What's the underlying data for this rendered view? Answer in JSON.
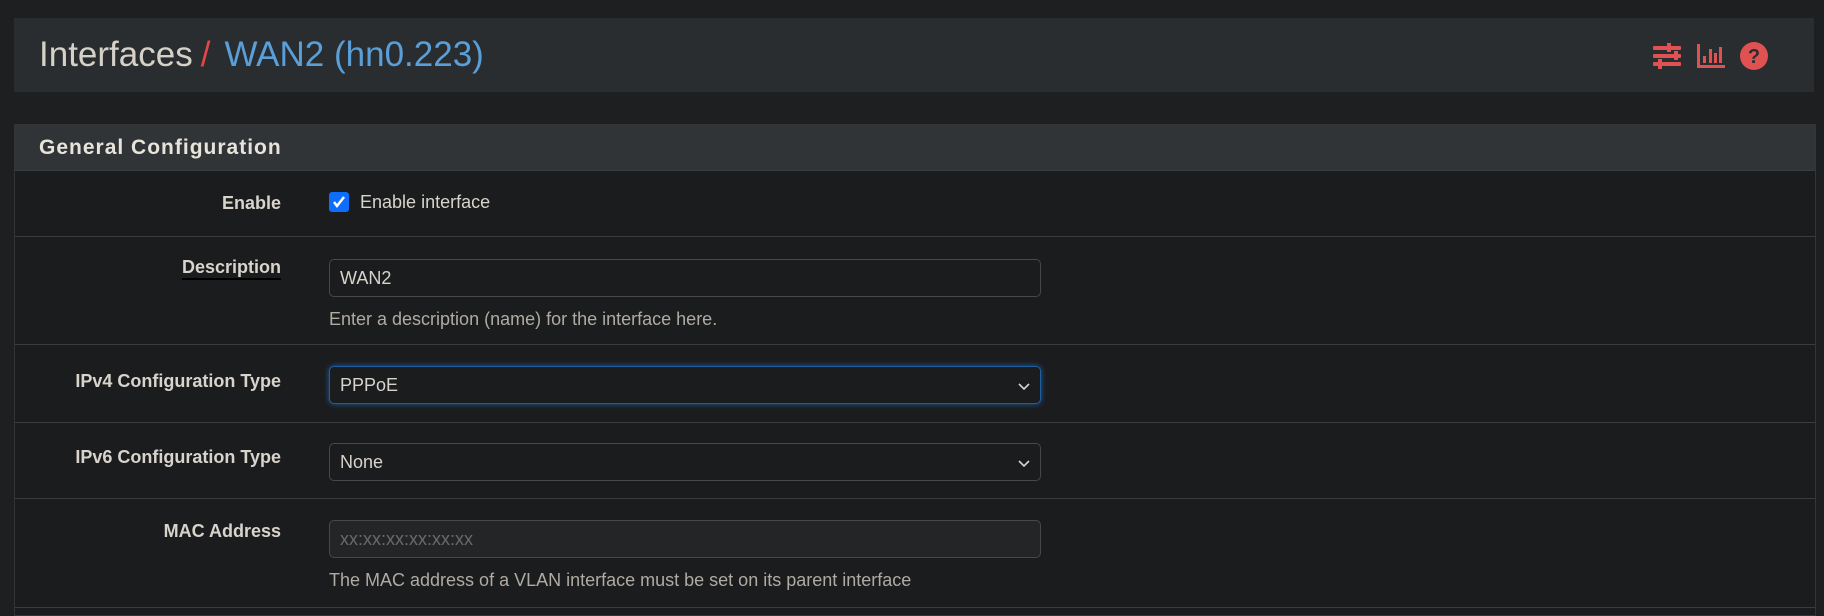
{
  "header": {
    "breadcrumb_root": "Interfaces",
    "separator": "/",
    "current": "WAN2 (hn0.223)",
    "icons": [
      "sliders-icon",
      "bar-chart-icon",
      "help-icon"
    ],
    "accent": "#e04848",
    "link_color": "#5a9fd8"
  },
  "panel": {
    "title": "General Configuration",
    "enable": {
      "label": "Enable",
      "checkbox_label": "Enable interface",
      "checked": true
    },
    "description": {
      "label": "Description",
      "value": "WAN2",
      "help": "Enter a description (name) for the interface here."
    },
    "ipv4": {
      "label": "IPv4 Configuration Type",
      "value": "PPPoE"
    },
    "ipv6": {
      "label": "IPv6 Configuration Type",
      "value": "None"
    },
    "mac": {
      "label": "MAC Address",
      "value": "",
      "placeholder": "xx:xx:xx:xx:xx:xx",
      "help": "The MAC address of a VLAN interface must be set on its parent interface"
    }
  }
}
